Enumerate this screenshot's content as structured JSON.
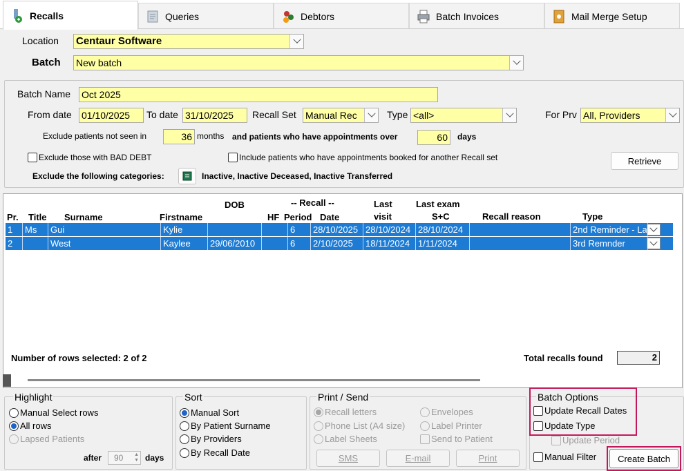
{
  "tabs": [
    {
      "label": "Recalls",
      "icon": "recall-icon"
    },
    {
      "label": "Queries",
      "icon": "queries-icon"
    },
    {
      "label": "Debtors",
      "icon": "debtors-icon"
    },
    {
      "label": "Batch Invoices",
      "icon": "printer-icon"
    },
    {
      "label": "Mail Merge Setup",
      "icon": "mail-merge-icon"
    }
  ],
  "location": {
    "label": "Location",
    "value": "Centaur Software"
  },
  "batch": {
    "label": "Batch",
    "value": "New batch"
  },
  "filters": {
    "batch_name_label": "Batch Name",
    "batch_name": "Oct 2025",
    "from_date_label": "From date",
    "from_date": "01/10/2025",
    "to_date_label": "To date",
    "to_date": "31/10/2025",
    "recall_set_label": "Recall Set",
    "recall_set": "Manual Rec",
    "type_label": "Type",
    "type": "<all>",
    "for_prv_label": "For Prv",
    "for_prv": "All,  Providers",
    "exclude_not_seen_label": "Exclude patients not seen in",
    "exclude_not_seen_value": "36",
    "months_label": "months",
    "appointments_over_label": "and patients who have appointments over",
    "appointments_over_value": "60",
    "days_label": "days",
    "bad_debt_label": "Exclude those with BAD DEBT",
    "another_recall_label": "Include patients who have appointments booked for another Recall set",
    "categories_label": "Exclude the following categories:",
    "categories_value": "Inactive, Inactive Deceased, Inactive Transferred",
    "retrieve_label": "Retrieve"
  },
  "grid": {
    "headers": {
      "pr": "Pr.",
      "title": "Title",
      "surname": "Surname",
      "firstname": "Firstname",
      "dob": "DOB",
      "hf": "HF",
      "recall_group": "-- Recall --",
      "period": "Period",
      "date": "Date",
      "last_visit_1": "Last",
      "last_visit_2": "visit",
      "last_exam_1": "Last exam",
      "last_exam_2": "S+C",
      "recall_reason": "Recall reason",
      "type": "Type"
    },
    "rows": [
      {
        "pr": "1",
        "title": "Ms",
        "surname": "Gui",
        "firstname": "Kylie",
        "dob": "",
        "hf": "",
        "period": "6",
        "date": "28/10/2025",
        "last_visit": "28/10/2024",
        "last_exam": "28/10/2024",
        "reason": "",
        "type": "2nd Reminder - La"
      },
      {
        "pr": "2",
        "title": "",
        "surname": "West",
        "firstname": "Kaylee",
        "dob": "29/06/2010",
        "hf": "",
        "period": "6",
        "date": "2/10/2025",
        "last_visit": "18/11/2024",
        "last_exam": "1/11/2024",
        "reason": "",
        "type": "3rd Remnder"
      }
    ],
    "rows_selected": "Number of rows selected: 2 of 2",
    "total_label": "Total recalls found",
    "total_value": "2"
  },
  "highlight": {
    "title": "Highlight",
    "manual": "Manual Select rows",
    "all": "All rows",
    "lapsed": "Lapsed Patients",
    "after_label": "after",
    "after_value": "90",
    "days_label": "days"
  },
  "sort": {
    "title": "Sort",
    "manual": "Manual Sort",
    "surname": "By Patient Surname",
    "providers": "By Providers",
    "recall_date": "By Recall Date"
  },
  "print_send": {
    "title": "Print / Send",
    "recall_letters": "Recall letters",
    "envelopes": "Envelopes",
    "phone_list": "Phone List (A4 size)",
    "label_printer": "Label Printer",
    "label_sheets": "Label Sheets",
    "send_to_patient": "Send to Patient",
    "sms": "SMS",
    "email": "E-mail",
    "print": "Print"
  },
  "batch_options": {
    "title": "Batch Options",
    "update_recall_dates": "Update Recall Dates",
    "update_type": "Update Type",
    "update_period": "Update Period",
    "manual_filter": "Manual Filter",
    "create_batch": "Create Batch"
  },
  "colors": {
    "selected_row": "#1e7bd3",
    "field_yellow": "#ffffa6",
    "highlight_border": "#c2185b"
  }
}
